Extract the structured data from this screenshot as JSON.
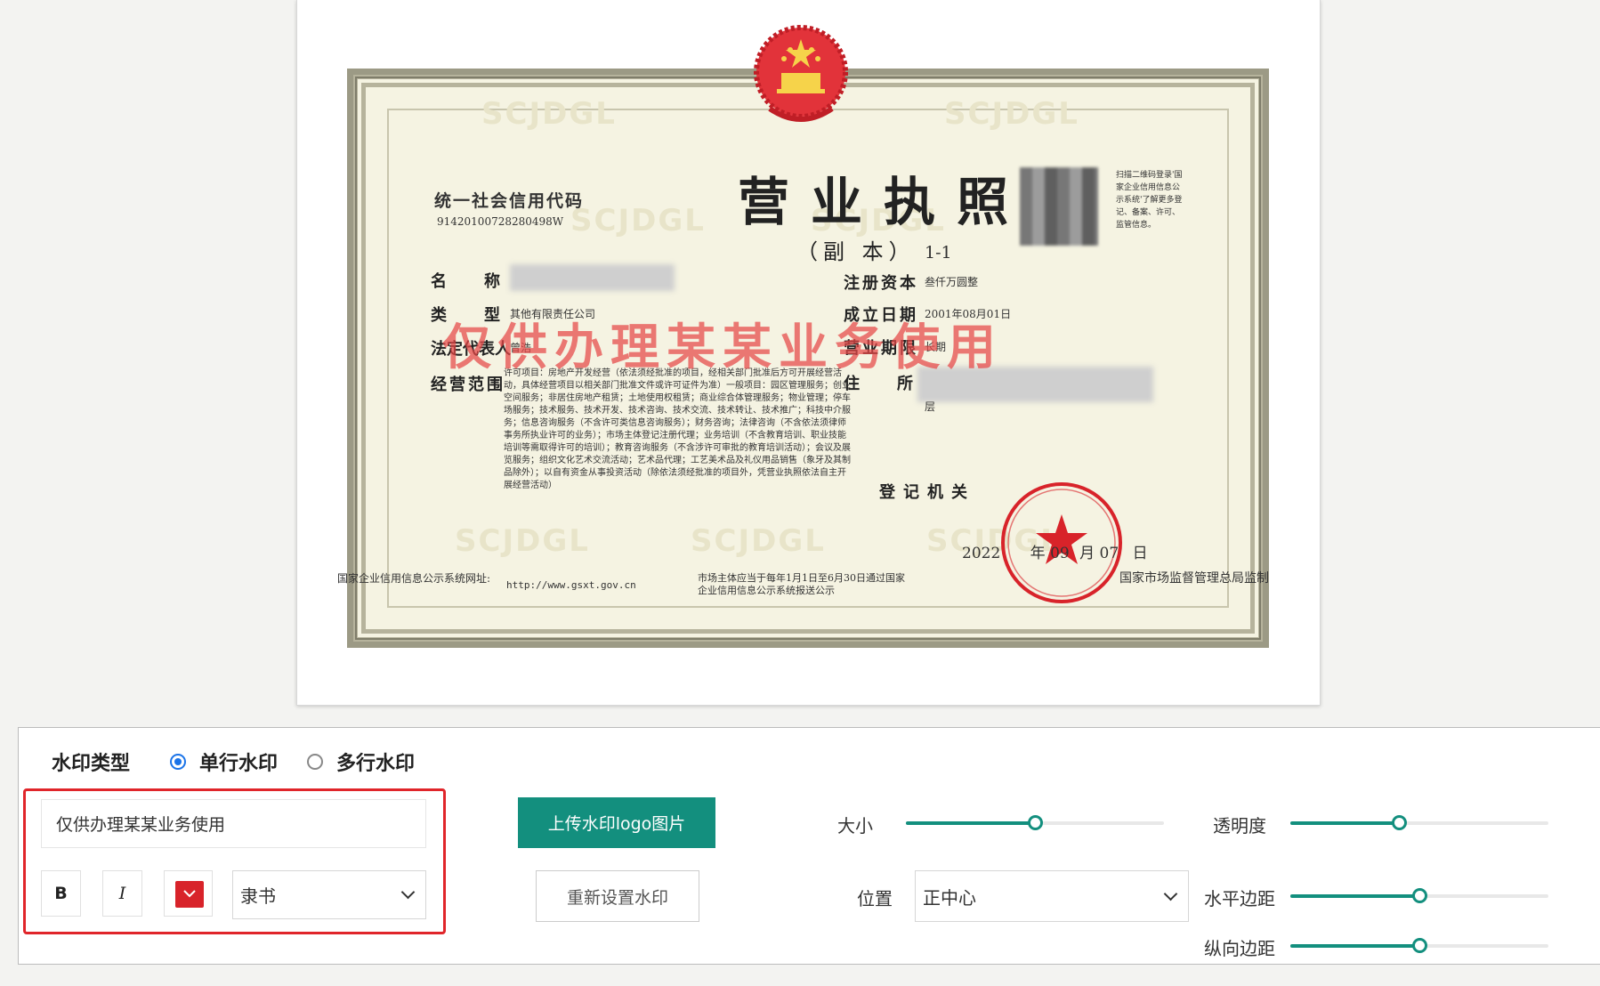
{
  "certificate": {
    "title": "营业执照",
    "copy_label": "（副 本）",
    "copy_number": "1-1",
    "credit_code_label": "统一社会信用代码",
    "credit_code": "91420100728280498W",
    "qr_note": "扫描二维码登录'国家企业信用信息公示系统'了解更多登记、备案、许可、监管信息。",
    "background_mark": "SCJDGL",
    "fields": {
      "name_label": "名　　称",
      "type_label": "类　　型",
      "type_value": "其他有限责任公司",
      "legal_rep_label": "法定代表人",
      "legal_rep_value": "曾浩",
      "scope_label": "经营范围",
      "scope_value": "许可项目：房地产开发经营（依法须经批准的项目，经相关部门批准后方可开展经营活动，具体经营项目以相关部门批准文件或许可证件为准）一般项目：园区管理服务；创业空间服务；非居住房地产租赁；土地使用权租赁；商业综合体管理服务；物业管理；停车场服务；技术服务、技术开发、技术咨询、技术交流、技术转让、技术推广；科技中介服务；信息咨询服务（不含许可类信息咨询服务）；财务咨询；法律咨询（不含依法须律师事务所执业许可的业务）；市场主体登记注册代理；业务培训（不含教育培训、职业技能培训等需取得许可的培训）；教育咨询服务（不含涉许可审批的教育培训活动）；会议及展览服务；组织文化艺术交流活动；艺术品代理；工艺美术品及礼仪用品销售（象牙及其制品除外）；以自有资金从事投资活动（除依法须经批准的项目外，凭营业执照依法自主开展经营活动）",
      "capital_label": "注册资本",
      "capital_value": "叁仟万圆整",
      "established_label": "成立日期",
      "established_value": "2001年08月01日",
      "term_label": "营业期限",
      "term_value": "长期",
      "address_label": "住　　所",
      "address_suffix": "层",
      "reg_org_label": "登记机关"
    },
    "date": {
      "year": "2022",
      "year_unit": "年",
      "month": "09",
      "month_unit": "月",
      "day": "07",
      "day_unit": "日"
    },
    "watermark_text": "仅供办理某某业务使用",
    "footer": {
      "site_label": "国家企业信用信息公示系统网址:",
      "site_url": "http://www.gsxt.gov.cn",
      "notice": "市场主体应当于每年1月1日至6月30日通过国家企业信用信息公示系统报送公示",
      "supervisor": "国家市场监督管理总局监制"
    }
  },
  "controls": {
    "type_label": "水印类型",
    "option_single": "单行水印",
    "option_multi": "多行水印",
    "selected_type": "单行水印",
    "text_value": "仅供办理某某业务使用",
    "bold_label": "B",
    "italic_label": "I",
    "font_color": "#d8232a",
    "font_value": "隶书",
    "upload_label": "上传水印logo图片",
    "reset_label": "重新设置水印",
    "size_label": "大小",
    "size_value": 0.5,
    "opacity_label": "透明度",
    "opacity_value": 0.42,
    "position_label": "位置",
    "position_value": "正中心",
    "h_margin_label": "水平边距",
    "h_margin_value": 0.5,
    "v_margin_label": "纵向边距",
    "v_margin_value": 0.5
  },
  "colors": {
    "accent": "#138f7e",
    "highlight": "#e0252a",
    "radio": "#1a73e8"
  }
}
